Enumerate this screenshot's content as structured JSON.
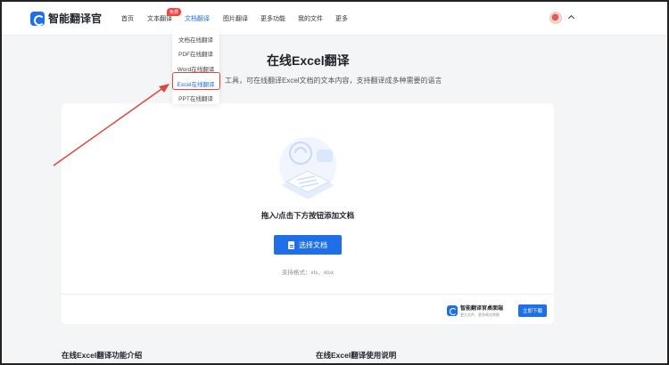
{
  "header": {
    "logo_text": "智能翻译官",
    "nav": [
      {
        "label": "首页"
      },
      {
        "label": "文本翻译"
      },
      {
        "label": "文档翻译"
      },
      {
        "label": "图片翻译"
      },
      {
        "label": "更多功能"
      },
      {
        "label": "我的文件"
      },
      {
        "label": "更多"
      }
    ],
    "badge": "免费",
    "active_nav": "文档翻译"
  },
  "dropdown": {
    "items": [
      {
        "label": "文档在线翻译"
      },
      {
        "label": "PDF在线翻译"
      },
      {
        "label": "Word在线翻译"
      },
      {
        "label": "Excel在线翻译"
      },
      {
        "label": "PPT在线翻译"
      }
    ],
    "highlighted": "Excel在线翻译"
  },
  "page": {
    "title": "在线Excel翻译",
    "subtitle": "工具，可在线翻译Excel文档的文本内容，支持翻译成多种需要的语言"
  },
  "upload": {
    "drop_text": "拖入/点击下方按钮添加文档",
    "button_label": "选择文档",
    "formats": "支持格式：xls、xlsx"
  },
  "promo": {
    "title": "智能翻译官桌面端",
    "subtitle": "更大文件、更多格式转换",
    "button_label": "立即下载"
  },
  "sections": {
    "intro_heading": "在线Excel翻译功能介绍",
    "howto_heading": "在线Excel翻译使用说明"
  },
  "colors": {
    "accent": "#1e6fe8",
    "highlight": "#e1463a",
    "badge": "#f5423e",
    "background": "#f4f5f7"
  },
  "icons": [
    "logo-icon",
    "avatar",
    "chevron-up-icon",
    "document-icon",
    "upload-illustration",
    "red-arrow-annotation"
  ]
}
